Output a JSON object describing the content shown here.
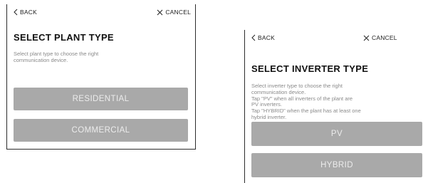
{
  "plant_screen": {
    "back_label": "BACK",
    "cancel_label": "CANCEL",
    "title": "SELECT PLANT TYPE",
    "description_lines": [
      "Select plant type to choose the right",
      "communication device."
    ],
    "options": [
      "RESIDENTIAL",
      "COMMERCIAL"
    ]
  },
  "inverter_screen": {
    "back_label": "BACK",
    "cancel_label": "CANCEL",
    "title": "SELECT INVERTER TYPE",
    "description_lines": [
      "Select inverter type to choose the right",
      "communication device.",
      "Tap \"PV\" when all inverters of the plant are",
      "PV inverters.",
      "Tap \"HYBRID\" when the plant has at least one",
      "hybrid inverter."
    ],
    "options": [
      "PV",
      "HYBRID"
    ]
  },
  "colors": {
    "button_bg": "#a9a9a9",
    "button_text": "#ececec",
    "description_text": "#8a8a8a"
  },
  "icons": {
    "back": "chevron-left-icon",
    "cancel": "close-icon"
  }
}
